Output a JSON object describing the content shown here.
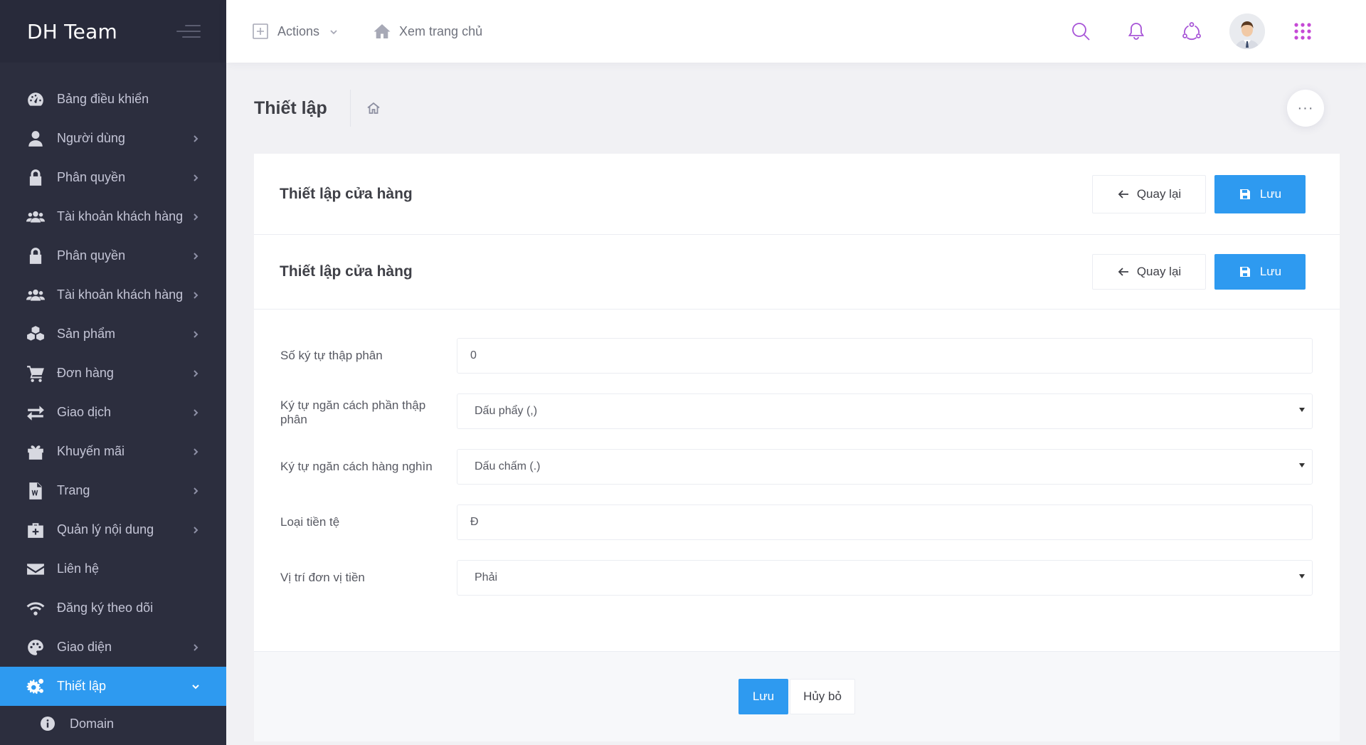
{
  "brand": {
    "name": "DH Team"
  },
  "topbar": {
    "actions_label": "Actions",
    "home_link_label": "Xem trang chủ",
    "accent_color": "#a754d7"
  },
  "sidebar": {
    "items": [
      {
        "label": "Bảng điều khiển",
        "icon": "dashboard-icon",
        "has_arrow": false
      },
      {
        "label": "Người dùng",
        "icon": "user-icon",
        "has_arrow": true
      },
      {
        "label": "Phân quyền",
        "icon": "lock-icon",
        "has_arrow": true
      },
      {
        "label": "Tài khoản khách hàng",
        "icon": "users-icon",
        "has_arrow": true
      },
      {
        "label": "Phân quyền",
        "icon": "lock-icon",
        "has_arrow": true
      },
      {
        "label": "Tài khoản khách hàng",
        "icon": "users-icon",
        "has_arrow": true
      },
      {
        "label": "Sản phẩm",
        "icon": "cubes-icon",
        "has_arrow": true
      },
      {
        "label": "Đơn hàng",
        "icon": "cart-icon",
        "has_arrow": true
      },
      {
        "label": "Giao dịch",
        "icon": "exchange-icon",
        "has_arrow": true
      },
      {
        "label": "Khuyến mãi",
        "icon": "gift-icon",
        "has_arrow": true
      },
      {
        "label": "Trang",
        "icon": "file-word-icon",
        "has_arrow": true
      },
      {
        "label": "Quản lý nội dung",
        "icon": "medkit-icon",
        "has_arrow": true
      },
      {
        "label": "Liên hệ",
        "icon": "envelope-icon",
        "has_arrow": false
      },
      {
        "label": "Đăng ký theo dõi",
        "icon": "wifi-icon",
        "has_arrow": false
      },
      {
        "label": "Giao diện",
        "icon": "palette-icon",
        "has_arrow": true
      },
      {
        "label": "Thiết lập",
        "icon": "cogs-icon",
        "has_arrow": true,
        "active": true
      }
    ],
    "subitems": [
      {
        "label": "Domain",
        "icon": "info-icon"
      }
    ],
    "active_color": "#2e9af0"
  },
  "subheader": {
    "title": "Thiết lập"
  },
  "portlet": {
    "title_1": "Thiết lập cửa hàng",
    "title_2": "Thiết lập cửa hàng",
    "back_label": "Quay lại",
    "save_label": "Lưu",
    "form": {
      "decimals": {
        "label": "Số ký tự thập phân",
        "value": "0"
      },
      "decimal_sep": {
        "label": "Ký tự ngăn cách phần thập phân",
        "value": "Dấu phẩy (,)"
      },
      "thousand_sep": {
        "label": "Ký tự ngăn cách hàng nghìn",
        "value": "Dấu chấm (.)"
      },
      "currency": {
        "label": "Loại tiền tệ",
        "value": "Đ"
      },
      "currency_pos": {
        "label": "Vị trí đơn vị tiền",
        "value": "Phải"
      }
    },
    "footer": {
      "save_label": "Lưu",
      "cancel_label": "Hủy bỏ"
    }
  }
}
